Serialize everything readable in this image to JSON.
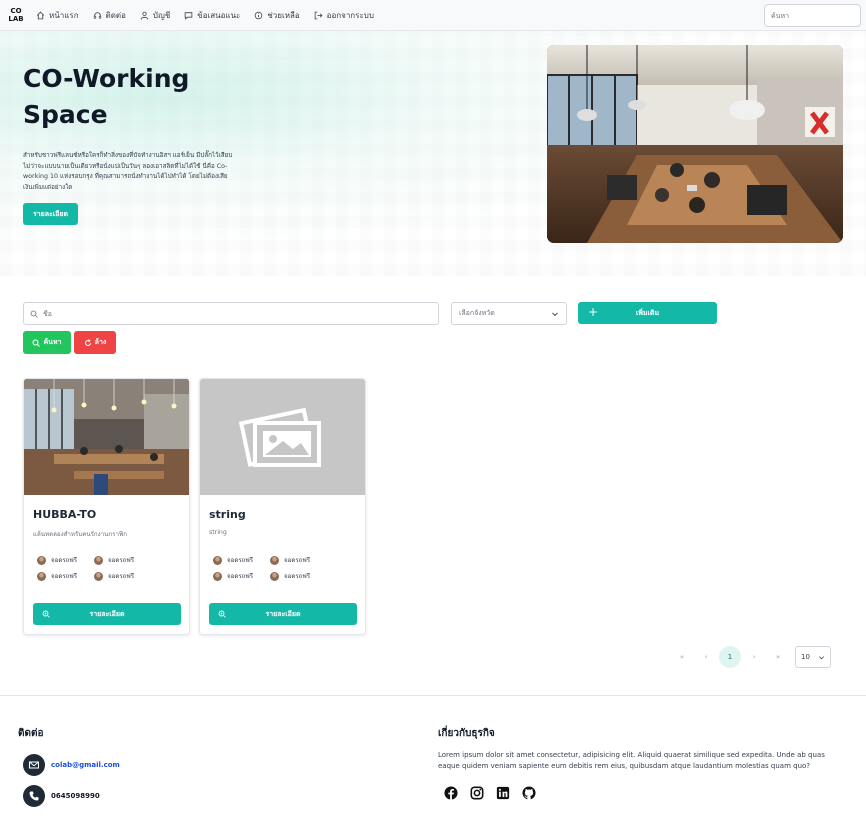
{
  "nav": {
    "logo_line1": "CO",
    "logo_line2": "LAB",
    "items": [
      {
        "label": "หน้าแรก",
        "icon": "home-icon"
      },
      {
        "label": "ติดต่อ",
        "icon": "headset-icon"
      },
      {
        "label": "บัญชี",
        "icon": "user-icon"
      },
      {
        "label": "ข้อเสนอแนะ",
        "icon": "chat-icon"
      },
      {
        "label": "ช่วยเหลือ",
        "icon": "info-icon"
      },
      {
        "label": "ออกจากระบบ",
        "icon": "logout-icon"
      }
    ],
    "search_placeholder": "ค้นหา"
  },
  "hero": {
    "title": "CO-Working Space",
    "description": "สำหรับชาวฟรีแลนซ์หรือใครก็ทำสิ่งของที่บัจทำงานอิสฯ แอร์เย็น มีปลั๊กไว้เสียบ ไม่ว่าจะแบบนายเป็นเดียวหรือนั่งแปเป็นวันๆ ลองเอาสลิตที่ไม่ได้ใช้ นี่คือ Co-working 10 แห่งรอบกรุง ที่คุณสามารถนั่งทำงานได้ไปทำได้ โดยไม่ต้องเสียเงินเพิ่มแต่อย่างใด",
    "button": "รายละเอียด",
    "image": "coworking-office-photo"
  },
  "filter": {
    "search_placeholder": "ชื่อ",
    "province_placeholder": "เลือกจังหวัด",
    "add_button": "เพิ่มเติม",
    "search_button": "ค้นหา",
    "clear_button": "ล้าง"
  },
  "cards": [
    {
      "title": "HUBBA-TO",
      "subtitle": "แล้นทดลองสำหรับคนรักงานกราฟิก",
      "image": "cafe-coworking-photo",
      "amenities": [
        "จอดรถฟรี",
        "จอดรถฟรี",
        "จอดรถฟรี",
        "จอดรถฟรี"
      ],
      "button": "รายละเอียด"
    },
    {
      "title": "string",
      "subtitle": "string",
      "image": "image-placeholder-icon",
      "amenities": [
        "จอดรถฟรี",
        "จอดรถฟรี",
        "จอดรถฟรี",
        "จอดรถฟรี"
      ],
      "button": "รายละเอียด"
    }
  ],
  "pagination": {
    "first": "«",
    "prev": "‹",
    "current": "1",
    "next": "›",
    "last": "»",
    "per_page": "10"
  },
  "footer": {
    "contact_title": "ติดต่อ",
    "email": "colab@gmail.com",
    "phone": "0645098990",
    "about_title": "เกี่ยวกับธุรกิจ",
    "about_text": "Lorem ipsum dolor sit amet consectetur, adipisicing elit. Aliquid quaerat similique sed expedita. Unde ab quas eaque quidem veniam sapiente eum debitis rem eius, quibusdam atque laudantium molestias quam quo?",
    "socials": [
      "facebook-icon",
      "instagram-icon",
      "linkedin-icon",
      "github-icon"
    ]
  },
  "colors": {
    "accent": "#14b8a6",
    "search_green": "#22c55e",
    "clear_red": "#ef4444",
    "email_link": "#1d4ed8"
  }
}
